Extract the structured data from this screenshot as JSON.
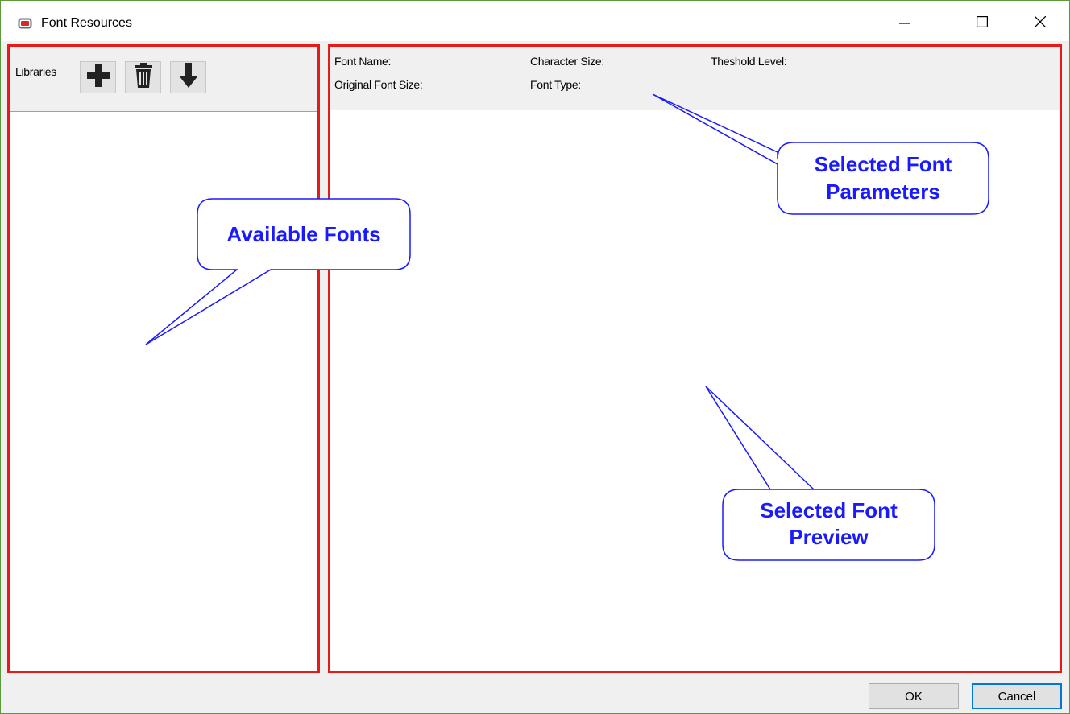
{
  "window": {
    "title": "Font Resources",
    "icons": {
      "app": "app-icon",
      "minimize": "minimize-icon",
      "maximize": "maximize-icon",
      "close": "close-icon"
    }
  },
  "left_panel": {
    "toolbar": {
      "label": "Libraries",
      "buttons": [
        {
          "icon": "plus-icon"
        },
        {
          "icon": "trash-icon"
        },
        {
          "icon": "arrow-down-icon"
        }
      ]
    }
  },
  "right_panel": {
    "params": {
      "font_name": "Font Name:",
      "original_font_size": "Original Font Size:",
      "character_size": "Character Size:",
      "font_type": "Font Type:",
      "threshold_level": "Theshold Level:"
    }
  },
  "footer": {
    "ok_label": "OK",
    "cancel_label": "Cancel"
  },
  "annotations": {
    "available_fonts": "Available Fonts",
    "selected_font_parameters": [
      "Selected Font",
      "Parameters"
    ],
    "selected_font_preview": [
      "Selected Font",
      "Preview"
    ]
  },
  "colors": {
    "highlight_border": "#e51a1a",
    "callout_text": "#1a1aff",
    "window_border": "#5a9a3a",
    "focus_border": "#0078d7"
  }
}
